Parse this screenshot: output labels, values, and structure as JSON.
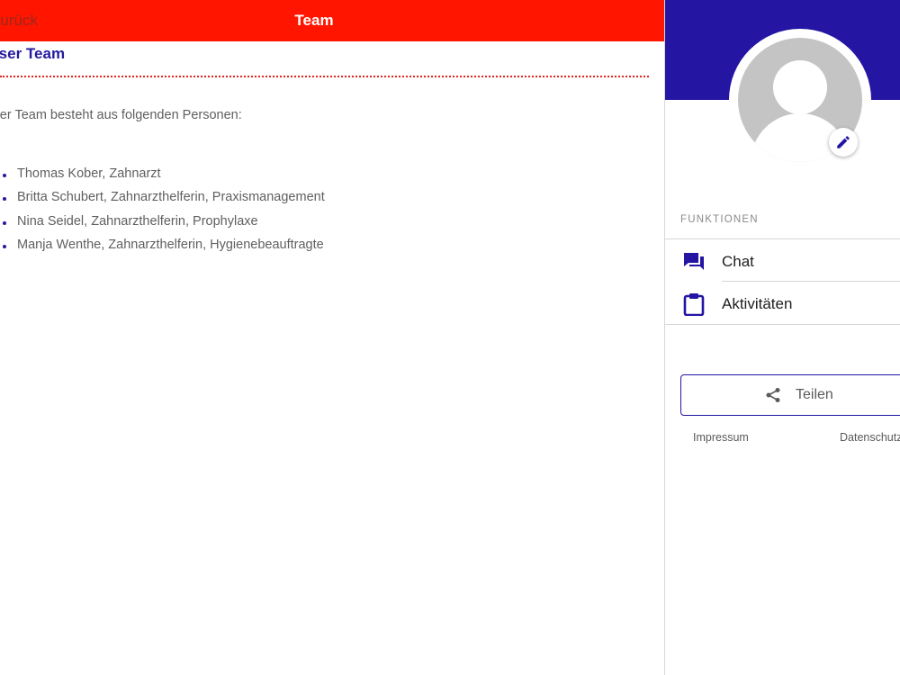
{
  "header": {
    "back_label": "Zurück",
    "title": "Team"
  },
  "content": {
    "heading": "Unser Team",
    "intro": "Unser Team besteht aus folgenden Personen:",
    "members": [
      "Thomas Kober, Zahnarzt",
      "Britta Schubert, Zahnarzthelferin, Praxismanagement",
      "Nina Seidel, Zahnarzthelferin, Prophylaxe",
      "Manja Wenthe, Zahnarzthelferin, Hygienebeauftragte"
    ]
  },
  "side_panel": {
    "section_label": "FUNKTIONEN",
    "menu": [
      {
        "label": "Chat",
        "icon": "chat-icon"
      },
      {
        "label": "Aktivitäten",
        "icon": "clipboard-icon"
      }
    ],
    "share_label": "Teilen",
    "footer": {
      "impressum": "Impressum",
      "datenschutz": "Datenschutz"
    }
  },
  "colors": {
    "top_bar": "#ff1500",
    "accent": "#2415a3",
    "heading": "#241a9e",
    "dotted_rule": "#e0231a"
  }
}
